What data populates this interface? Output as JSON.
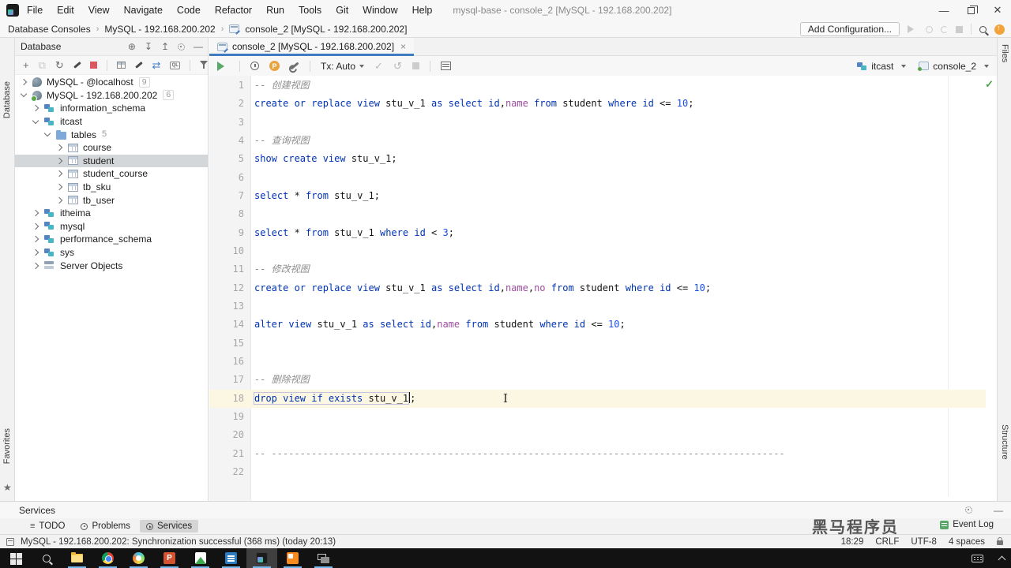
{
  "titlebar": {
    "menus": [
      "File",
      "Edit",
      "View",
      "Navigate",
      "Code",
      "Refactor",
      "Run",
      "Tools",
      "Git",
      "Window",
      "Help"
    ],
    "title": "mysql-base - console_2 [MySQL - 192.168.200.202]"
  },
  "navbar": {
    "breadcrumbs": [
      "Database Consoles",
      "MySQL - 192.168.200.202",
      "console_2 [MySQL - 192.168.200.202]"
    ],
    "add_configuration": "Add Configuration..."
  },
  "strips": {
    "left_top": "Database",
    "left_bottom": "Favorites",
    "right_top": "Files",
    "right_bottom": "Structure"
  },
  "database_panel": {
    "title": "Database",
    "tree": [
      {
        "level": 0,
        "open": false,
        "icon": "db",
        "label": "MySQL - @localhost",
        "badge": "9"
      },
      {
        "level": 0,
        "open": true,
        "icon": "db",
        "online": true,
        "label": "MySQL - 192.168.200.202",
        "badge": "6"
      },
      {
        "level": 1,
        "open": false,
        "icon": "schema",
        "label": "information_schema"
      },
      {
        "level": 1,
        "open": true,
        "icon": "schema",
        "label": "itcast"
      },
      {
        "level": 2,
        "open": true,
        "icon": "folder",
        "label": "tables",
        "badge": "5",
        "badge_plain": true
      },
      {
        "level": 3,
        "open": false,
        "icon": "table",
        "label": "course"
      },
      {
        "level": 3,
        "open": false,
        "icon": "table",
        "label": "student",
        "selected": true
      },
      {
        "level": 3,
        "open": false,
        "icon": "table",
        "label": "student_course"
      },
      {
        "level": 3,
        "open": false,
        "icon": "table",
        "label": "tb_sku"
      },
      {
        "level": 3,
        "open": false,
        "icon": "table",
        "label": "tb_user"
      },
      {
        "level": 1,
        "open": false,
        "icon": "schema",
        "label": "itheima"
      },
      {
        "level": 1,
        "open": false,
        "icon": "schema",
        "label": "mysql"
      },
      {
        "level": 1,
        "open": false,
        "icon": "schema",
        "label": "performance_schema"
      },
      {
        "level": 1,
        "open": false,
        "icon": "schema",
        "label": "sys"
      },
      {
        "level": 1,
        "open": false,
        "icon": "server",
        "label": "Server Objects"
      }
    ]
  },
  "editor": {
    "tab": "console_2 [MySQL - 192.168.200.202]",
    "tab_close": "×",
    "toolbar": {
      "tx": "Tx: Auto",
      "schema": "itcast",
      "console": "console_2"
    },
    "lines": [
      {
        "n": 1,
        "seg": [
          [
            "c",
            "-- 创建视图"
          ]
        ]
      },
      {
        "n": 2,
        "seg": [
          [
            "k",
            "create or replace view"
          ],
          [
            "t",
            " stu_v_1 "
          ],
          [
            "k",
            "as select"
          ],
          [
            "t",
            " "
          ],
          [
            "k",
            "id"
          ],
          [
            "t",
            ","
          ],
          [
            "p",
            "name"
          ],
          [
            "t",
            " "
          ],
          [
            "k",
            "from"
          ],
          [
            "t",
            " student "
          ],
          [
            "k",
            "where"
          ],
          [
            "t",
            " "
          ],
          [
            "k",
            "id"
          ],
          [
            "t",
            " <= "
          ],
          [
            "n",
            "10"
          ],
          [
            "t",
            ";"
          ]
        ]
      },
      {
        "n": 3,
        "seg": []
      },
      {
        "n": 4,
        "seg": [
          [
            "c",
            "-- 查询视图"
          ]
        ]
      },
      {
        "n": 5,
        "seg": [
          [
            "k",
            "show create view"
          ],
          [
            "t",
            " stu_v_1;"
          ]
        ]
      },
      {
        "n": 6,
        "seg": []
      },
      {
        "n": 7,
        "seg": [
          [
            "k",
            "select"
          ],
          [
            "t",
            " * "
          ],
          [
            "k",
            "from"
          ],
          [
            "t",
            " stu_v_1;"
          ]
        ]
      },
      {
        "n": 8,
        "seg": []
      },
      {
        "n": 9,
        "seg": [
          [
            "k",
            "select"
          ],
          [
            "t",
            " * "
          ],
          [
            "k",
            "from"
          ],
          [
            "t",
            " stu_v_1 "
          ],
          [
            "k",
            "where"
          ],
          [
            "t",
            " "
          ],
          [
            "k",
            "id"
          ],
          [
            "t",
            " < "
          ],
          [
            "n",
            "3"
          ],
          [
            "t",
            ";"
          ]
        ]
      },
      {
        "n": 10,
        "seg": []
      },
      {
        "n": 11,
        "seg": [
          [
            "c",
            "-- 修改视图"
          ]
        ]
      },
      {
        "n": 12,
        "seg": [
          [
            "k",
            "create or replace view"
          ],
          [
            "t",
            " stu_v_1 "
          ],
          [
            "k",
            "as select"
          ],
          [
            "t",
            " "
          ],
          [
            "k",
            "id"
          ],
          [
            "t",
            ","
          ],
          [
            "p",
            "name"
          ],
          [
            "t",
            ","
          ],
          [
            "p",
            "no"
          ],
          [
            "t",
            " "
          ],
          [
            "k",
            "from"
          ],
          [
            "t",
            " student "
          ],
          [
            "k",
            "where"
          ],
          [
            "t",
            " "
          ],
          [
            "k",
            "id"
          ],
          [
            "t",
            " <= "
          ],
          [
            "n",
            "10"
          ],
          [
            "t",
            ";"
          ]
        ]
      },
      {
        "n": 13,
        "seg": []
      },
      {
        "n": 14,
        "seg": [
          [
            "k",
            "alter view"
          ],
          [
            "t",
            " stu_v_1 "
          ],
          [
            "k",
            "as select"
          ],
          [
            "t",
            " "
          ],
          [
            "k",
            "id"
          ],
          [
            "t",
            ","
          ],
          [
            "p",
            "name"
          ],
          [
            "t",
            " "
          ],
          [
            "k",
            "from"
          ],
          [
            "t",
            " student "
          ],
          [
            "k",
            "where"
          ],
          [
            "t",
            " "
          ],
          [
            "k",
            "id"
          ],
          [
            "t",
            " <= "
          ],
          [
            "n",
            "10"
          ],
          [
            "t",
            ";"
          ]
        ]
      },
      {
        "n": 15,
        "seg": []
      },
      {
        "n": 16,
        "seg": []
      },
      {
        "n": 17,
        "seg": [
          [
            "c",
            "-- 删除视图"
          ]
        ]
      },
      {
        "n": 18,
        "cur": true,
        "box": 2,
        "caret": true,
        "seg": [
          [
            "k",
            "drop view if exists"
          ],
          [
            "t",
            " stu_v_1"
          ],
          [
            "t",
            ";"
          ]
        ]
      },
      {
        "n": 19,
        "seg": []
      },
      {
        "n": 20,
        "seg": []
      },
      {
        "n": 21,
        "seg": [
          [
            "c",
            "-- ------------------------------------------------------------------------------------------"
          ]
        ]
      },
      {
        "n": 22,
        "seg": []
      }
    ]
  },
  "bottom": {
    "services_title": "Services",
    "tabs": [
      {
        "label": "TODO",
        "icon": "todo"
      },
      {
        "label": "Problems",
        "icon": "problems"
      },
      {
        "label": "Services",
        "icon": "services",
        "active": true
      }
    ],
    "event_log": "Event Log",
    "status_message": "MySQL - 192.168.200.202: Synchronization successful (368 ms) (today 20:13)",
    "status_right": [
      "18:29",
      "CRLF",
      "UTF-8",
      "4 spaces"
    ]
  },
  "watermark": "黑马程序员",
  "taskbar": {
    "icons": [
      {
        "name": "start",
        "running": false
      },
      {
        "name": "search",
        "running": false
      },
      {
        "name": "explorer",
        "running": true
      },
      {
        "name": "chrome",
        "running": true
      },
      {
        "name": "appcircle",
        "running": true
      },
      {
        "name": "ppt",
        "running": true
      },
      {
        "name": "imgview",
        "running": true
      },
      {
        "name": "vmware",
        "running": true
      },
      {
        "name": "datagrip",
        "running": true,
        "active": true
      },
      {
        "name": "orange",
        "running": true
      },
      {
        "name": "monitors",
        "running": true
      }
    ]
  },
  "colors": {
    "keyword": "#0033B3",
    "number": "#1750EB",
    "comment": "#8C8C8C",
    "purple": "#9E4D9E",
    "accent_tab": "#3E7BC0",
    "run_green": "#59A869",
    "stop_red": "#DB5860"
  }
}
